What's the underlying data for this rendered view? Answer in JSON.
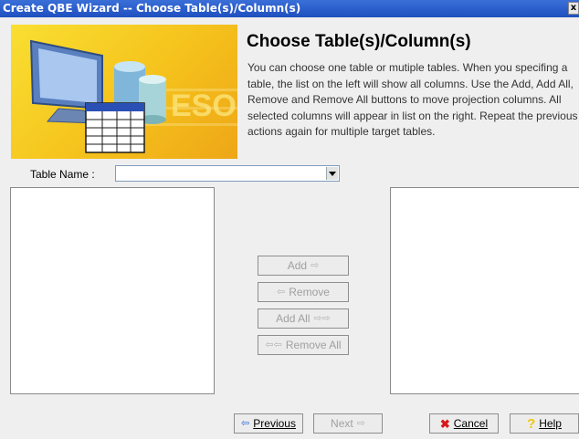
{
  "window": {
    "title": "Create QBE Wizard -- Choose Table(s)/Column(s)",
    "close_glyph": "x"
  },
  "header": {
    "title": "Choose Table(s)/Column(s)",
    "description": "You can choose one table or mutiple tables. When you specifing a table, the list on the left will show all columns. Use the Add, Add All, Remove and Remove All buttons to move projection columns. All selected columns will appear in list on the right. Repeat the previous actions again for multiple target tables.",
    "banner_watermark": "ESOF"
  },
  "table_name": {
    "label": "Table Name :",
    "value": ""
  },
  "transfer_buttons": {
    "add": "Add",
    "remove": "Remove",
    "add_all": "Add All",
    "remove_all": "Remove All"
  },
  "footer": {
    "previous": "Previous",
    "next": "Next",
    "cancel": "Cancel",
    "help": "Help"
  },
  "colors": {
    "titlebar": "#2858c8",
    "banner_yellow": "#f5c21c",
    "cancel_icon": "#d81818",
    "help_icon": "#f0c800",
    "arrow_icon": "#2a6bd6"
  }
}
